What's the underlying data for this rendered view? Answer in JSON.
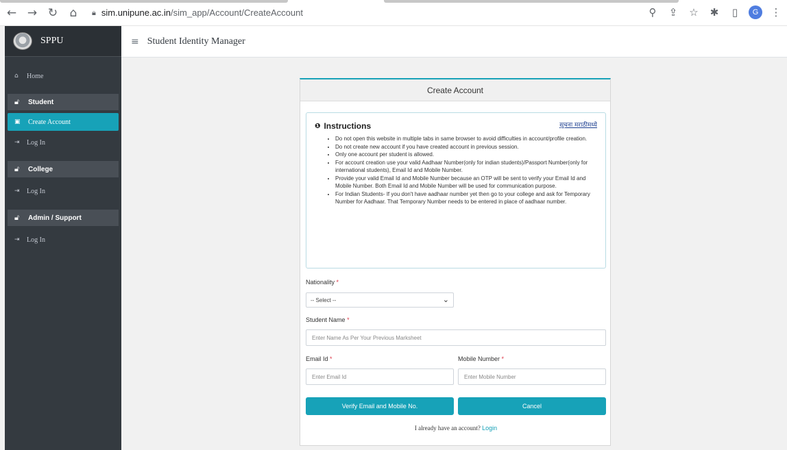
{
  "browser": {
    "back_icon": "arrow-left-icon",
    "forward_icon": "arrow-right-icon",
    "reload_icon": "reload-icon",
    "home_icon": "home-icon",
    "url_domain": "sim.unipune.ac.in",
    "url_path": "/sim_app/Account/CreateAccount",
    "profile_initial": "G"
  },
  "sidebar": {
    "brand": "SPPU",
    "home": "Home",
    "sections": [
      {
        "header": "Student",
        "items": [
          "Create Account",
          "Log In"
        ]
      },
      {
        "header": "College",
        "items": [
          "Log In"
        ]
      },
      {
        "header": "Admin / Support",
        "items": [
          "Log In"
        ]
      }
    ]
  },
  "header": {
    "title": "Student Identity Manager"
  },
  "card": {
    "title": "Create Account",
    "instructions": {
      "title": "Instructions",
      "marathi_link": "सूचना मराठीमध्ये",
      "items": [
        "Do not open this website in multiple tabs in same browser to avoid difficulties in account/profile creation.",
        "Do not create new account if you have created account in previous session.",
        "Only one account per student is allowed.",
        "For account creation use your valid Aadhaar Number(only for indian students)/Passport Number(only for international students), Email Id and Mobile Number.",
        "Provide your valid Email Id and Mobile Number because an OTP will be sent to verify your Email Id and Mobile Number. Both Email Id and Mobile Number will be used for communication purpose.",
        "For Indian Students- If you don't have aadhaar number yet then go to your college and ask for Temporary Number for Aadhaar. That Temporary Number needs to be entered in place of aadhaar number."
      ]
    },
    "nationality_label": "Nationality",
    "nationality_value": "-- Select --",
    "student_name_label": "Student Name",
    "student_name_placeholder": "Enter Name As Per Your Previous Marksheet",
    "email_label": "Email Id",
    "email_placeholder": "Enter Email Id",
    "mobile_label": "Mobile Number",
    "mobile_placeholder": "Enter Mobile Number",
    "required_mark": "*",
    "verify_button": "Verify Email and Mobile No.",
    "cancel_button": "Cancel",
    "footer_text": "I already have an account?",
    "login_link": "Login"
  },
  "colors": {
    "accent": "#17a2b8",
    "sidebar_bg": "#343a40",
    "required": "#dc3545"
  }
}
